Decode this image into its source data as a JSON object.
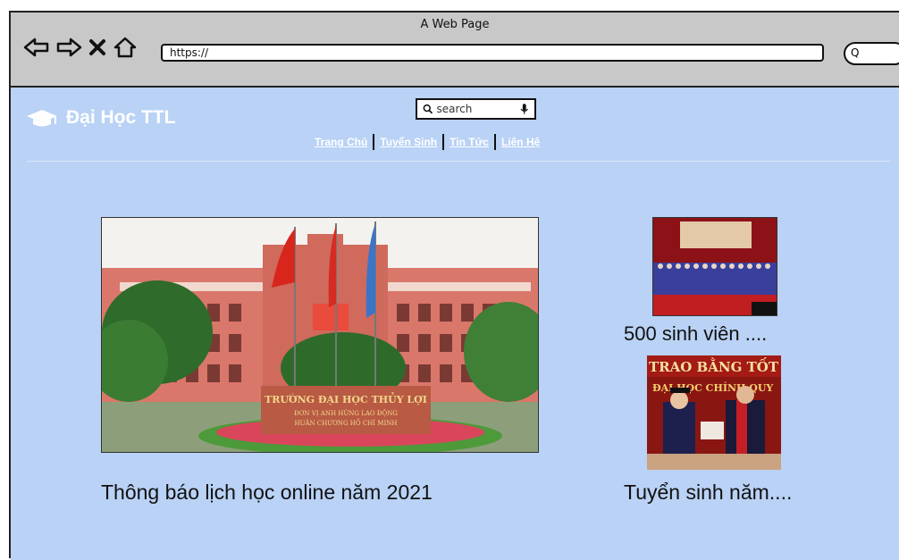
{
  "window": {
    "title": "A Web Page"
  },
  "browser": {
    "url": "https://",
    "search_glyph": "Q"
  },
  "site": {
    "brand": "Đại Học TTL",
    "search_placeholder": "search",
    "menu": [
      {
        "label": "Trang Chủ"
      },
      {
        "label": "Tuyển Sinh"
      },
      {
        "label": "Tin Tức"
      },
      {
        "label": "Liên Hệ"
      }
    ]
  },
  "main_article": {
    "title": "Thông báo lịch học online năm 2021",
    "image_sign": [
      "TRƯỜNG ĐẠI HỌC THỦY LỢI",
      "ĐƠN VỊ ANH HÙNG LAO ĐỘNG",
      "HUÂN CHƯƠNG HỒ CHÍ MINH"
    ]
  },
  "side_articles": [
    {
      "title": "500 sinh viên ...."
    },
    {
      "title": "Tuyển sinh năm....",
      "image_banner": [
        "TRAO BẰNG TỐT NGH",
        "ĐẠI HỌC CHÍNH QUY"
      ]
    }
  ],
  "colors": {
    "page_bg": "#b9d2f5",
    "chrome": "#c8c8c8",
    "text": "#111111"
  }
}
